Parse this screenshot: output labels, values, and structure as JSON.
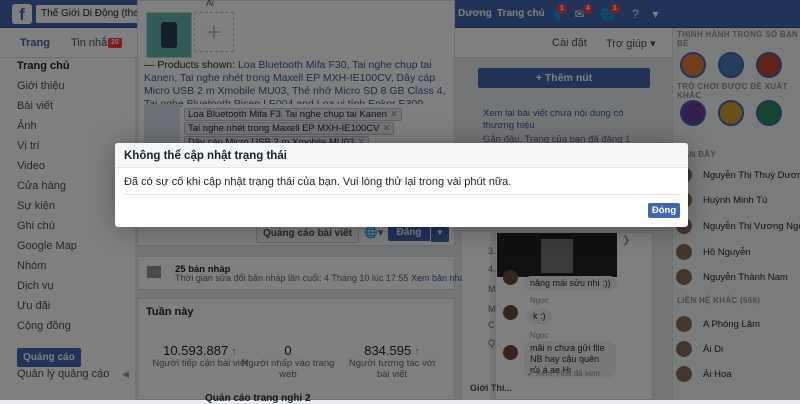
{
  "topbar": {
    "search_value": "Thế Giới Di Động (thegioidi",
    "nav_duong": "Dương",
    "nav_home": "Trang chủ",
    "friends_badge": "1",
    "messages_badge": "4",
    "notifications_badge": "1"
  },
  "pagebar": {
    "tab_page": "Trang",
    "tab_messages": "Tin nhắn",
    "messages_count": "20",
    "settings": "Cài đặt",
    "help": "Trợ giúp ▾"
  },
  "sidebar": {
    "items": [
      "Trang chủ",
      "Giới thiệu",
      "Bài viết",
      "Ảnh",
      "Vị trí",
      "Video",
      "Cửa hàng",
      "Sự kiện",
      "Ghi chú",
      "Google Map",
      "Nhóm",
      "Dịch vụ",
      "Ưu đãi",
      "Cộng đồng"
    ],
    "ads_button": "Quảng cáo",
    "manage_ads": "Quản lý quảng cáo"
  },
  "composer": {
    "snippet_top": "Ai",
    "products_prefix": "— Products shown: ",
    "products_text": "Loa Bluetooth Mifa F30, Tai nghe chụp tai Kanen, Tai nghe nhét trong Maxell EP MXH-IE100CV, Dây cáp Micro USB 2 m Xmobile MU03, Thẻ nhớ Micro SD 8 GB Class 4, Tai nghe Bluetooth Pisen LE004 and Loa vi tính Enkor E300 Plus.",
    "tags": [
      "Loa Bluetooth Mifa F30",
      "Tai nghe chụp tai Kanen",
      "Tai nghe nhét trong Maxell EP MXH-IE100CV",
      "Dây cáp Micro USB 2 m Xmobile MU03"
    ],
    "boost_button": "Quảng cáo bài viết",
    "post_button": "Đăng"
  },
  "drafts": {
    "title": "25 bản nháp",
    "desc_prefix": "Thời gian sửa đổi bản nháp lần cuối: 4 Tháng 10 lúc 17:55 ",
    "desc_link": "Xem bản nháp"
  },
  "week": {
    "title": "Tuần này",
    "stats": [
      {
        "value": "10.593.887",
        "label": "Người tiếp cận bài viết"
      },
      {
        "value": "0",
        "label": "Người nhấp vào trang web"
      },
      {
        "value": "834.595",
        "label": "Người tương tác với bài viết"
      }
    ],
    "bottom_text": "Quản cáo trang nghi 2"
  },
  "right": {
    "add_button": "+ Thêm nút",
    "text1": "Xem lại bài viết chưa nội dung có thương hiệu",
    "text2": "Gắn đậu. Trang của bạn đã đăng 1 Trang bị"
  },
  "inbox_items": [
    "3...",
    "4...",
    "Mi...",
    "Mi...",
    "Ch...",
    "Qu..."
  ],
  "chat": {
    "msg1": "nâng mái sửu nhi :))",
    "name2": "Ngọc",
    "msg2": "k :)",
    "name3": "Ngọc",
    "name4": "Ngọc",
    "msg4": "mãi n chưa gửi file NB hay cậu quên rủi á ae Hi",
    "footer": "✓ Xem, Hòa đã xem"
  },
  "giotinh": "Giới Thi...",
  "sideright": {
    "section1": "THỊNH HÀNH TRONG SỐ BẠN BÈ",
    "section1b": "TRÒ CHƠI ĐƯỢC ĐỀ XUẤT KHÁC",
    "section2": "GẦN ĐÂY",
    "contacts": [
      "Nguyễn Thị Thuỳ Dương",
      "Huỳnh Minh Tú",
      "Nguyễn Thị Vương Ngọc",
      "Hồ Nguyễn",
      "Nguyễn Thành Nam"
    ],
    "section3": "LIÊN HỆ KHÁC (666)",
    "contacts2": [
      "A Phóng Lâm",
      "Ái Di",
      "Ái Hoa"
    ]
  },
  "dialog": {
    "title": "Không thể cập nhật trạng thái",
    "message": "Đã có sự cố khi cập nhật trạng thái của bạn. Vui lòng thử lại trong vài phút nữa.",
    "ok_button": "Đóng"
  },
  "colors": {
    "brand": "#4267b2",
    "page_bg": "#e9ebee",
    "overlay": "rgba(0,0,0,0.5)"
  }
}
